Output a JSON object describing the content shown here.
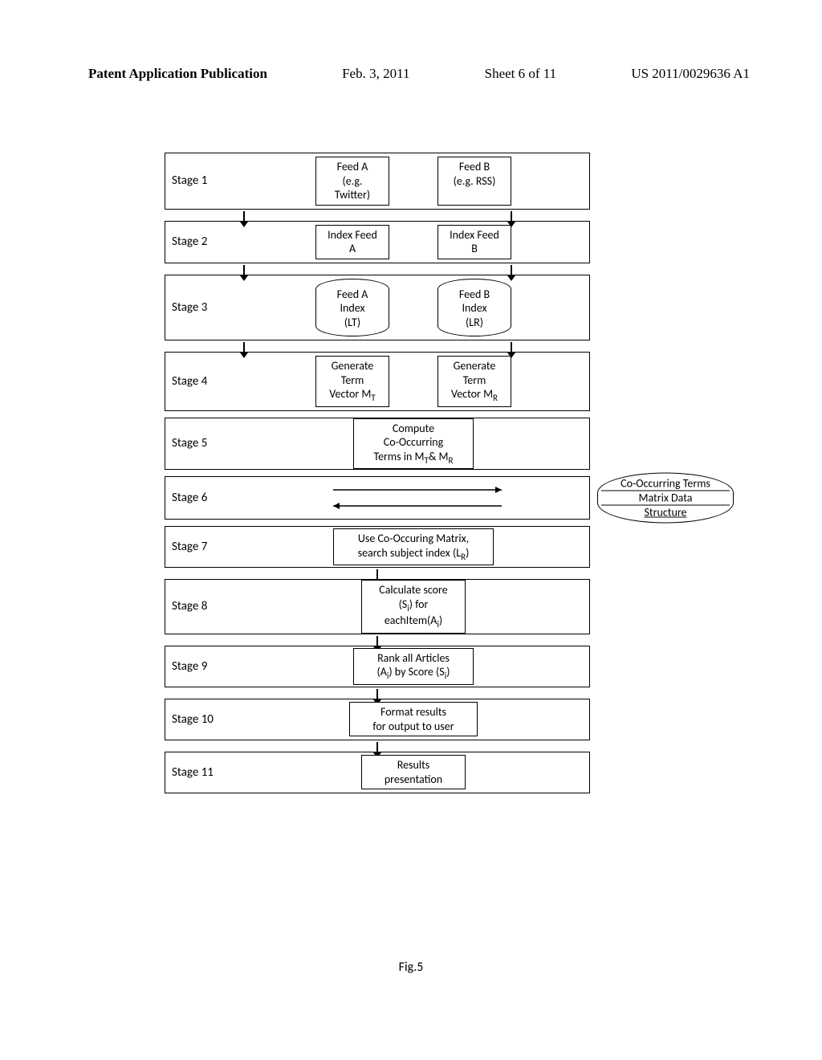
{
  "header": {
    "publication_label": "Patent Application Publication",
    "date": "Feb. 3, 2011",
    "sheet": "Sheet 6 of 11",
    "pub_no": "US 2011/0029636 A1"
  },
  "caption": "Fig.5",
  "stages": {
    "s1": {
      "label": "Stage 1",
      "a": "Feed A\n(e.g.\nTwitter)",
      "b": "Feed B\n(e.g. RSS)"
    },
    "s2": {
      "label": "Stage 2",
      "a": "Index Feed\nA",
      "b": "Index Feed\nB"
    },
    "s3": {
      "label": "Stage 3",
      "a": "Feed A\nIndex\n(LT)",
      "b": "Feed B\nIndex\n(LR)"
    },
    "s4": {
      "label": "Stage 4",
      "a": "Generate\nTerm\nVector M",
      "a_sub": "T",
      "b": "Generate\nTerm\nVector M",
      "b_sub": "R"
    },
    "s5": {
      "label": "Stage 5",
      "text": "Compute\nCo-Occurring\nTerms in M",
      "sub1": "T",
      "mid": "& M",
      "sub2": "R"
    },
    "s6": {
      "label": "Stage 6",
      "disk": [
        "Co-Occurring Terms",
        "Matrix Data",
        "Structure"
      ]
    },
    "s7": {
      "label": "Stage 7",
      "text": "Use Co-Occuring Matrix,\nsearch subject index (L",
      "sub": "R",
      "after": ")"
    },
    "s8": {
      "label": "Stage 8",
      "text": "Calculate score\n(S",
      "sub1": "i",
      "mid": ") for\neachItem(A",
      "sub2": "i",
      "after": ")"
    },
    "s9": {
      "label": "Stage 9",
      "text": "Rank all Articles\n(A",
      "sub1": "i",
      "mid": ") by Score (S",
      "sub2": "i",
      "after": ")"
    },
    "s10": {
      "label": "Stage 10",
      "text": "Format results\nfor output to user"
    },
    "s11": {
      "label": "Stage 11",
      "text": "Results\npresentation"
    }
  }
}
